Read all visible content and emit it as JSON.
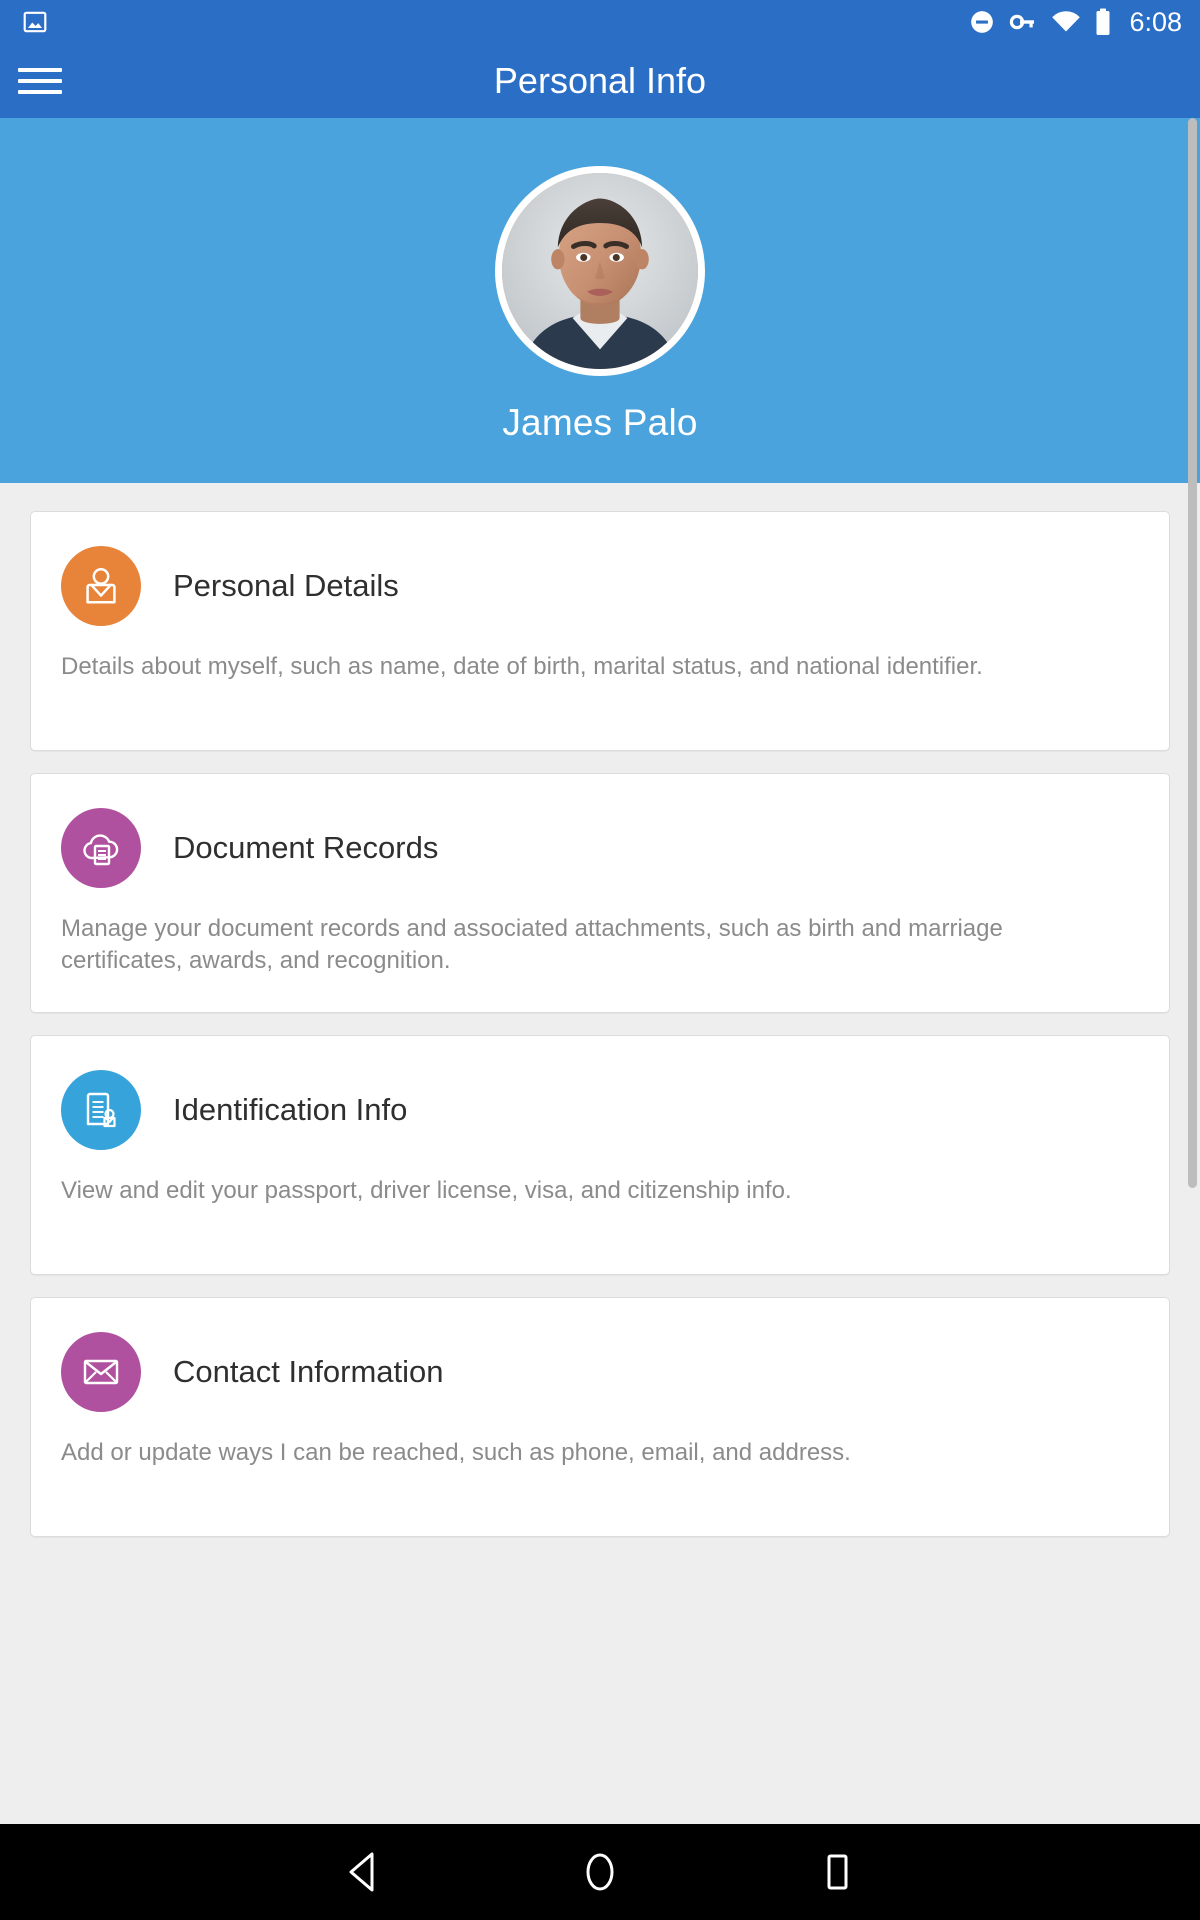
{
  "status_bar": {
    "notification_icon": "image-icon",
    "icons": [
      "do-not-disturb-icon",
      "vpn-key-icon",
      "wifi-icon",
      "battery-icon"
    ],
    "time": "6:08"
  },
  "toolbar": {
    "menu_icon": "hamburger-menu-icon",
    "title": "Personal Info"
  },
  "profile": {
    "avatar_icon": "user-photo-avatar",
    "name": "James Palo"
  },
  "colors": {
    "toolbar": "#2a6ec6",
    "hero": "#4aa3dd",
    "page_background": "#eeeeee",
    "card_background": "#ffffff",
    "card_border": "#dcdcdc",
    "title_text": "#2f2f2f",
    "description_text": "#8b8b8b",
    "navbar": "#000000"
  },
  "cards": [
    {
      "title": "Personal Details",
      "description": "Details about myself, such as name, date of birth, marital status, and national identifier.",
      "icon": "person-outline-icon",
      "icon_color": "#e8833a"
    },
    {
      "title": "Document Records",
      "description": "Manage your document records and associated attachments, such as birth and marriage certificates, awards, and recognition.",
      "icon": "cloud-document-icon",
      "icon_color": "#b0519f"
    },
    {
      "title": "Identification Info",
      "description": "View and edit your passport, driver license, visa, and citizenship info.",
      "icon": "id-document-icon",
      "icon_color": "#36a3db"
    },
    {
      "title": "Contact Information",
      "description": "Add or update ways I can be reached, such as phone, email, and address.",
      "icon": "envelope-icon",
      "icon_color": "#b0519f"
    }
  ],
  "navbar": {
    "back": "back-triangle-icon",
    "home": "home-circle-icon",
    "recents": "recents-square-icon"
  }
}
